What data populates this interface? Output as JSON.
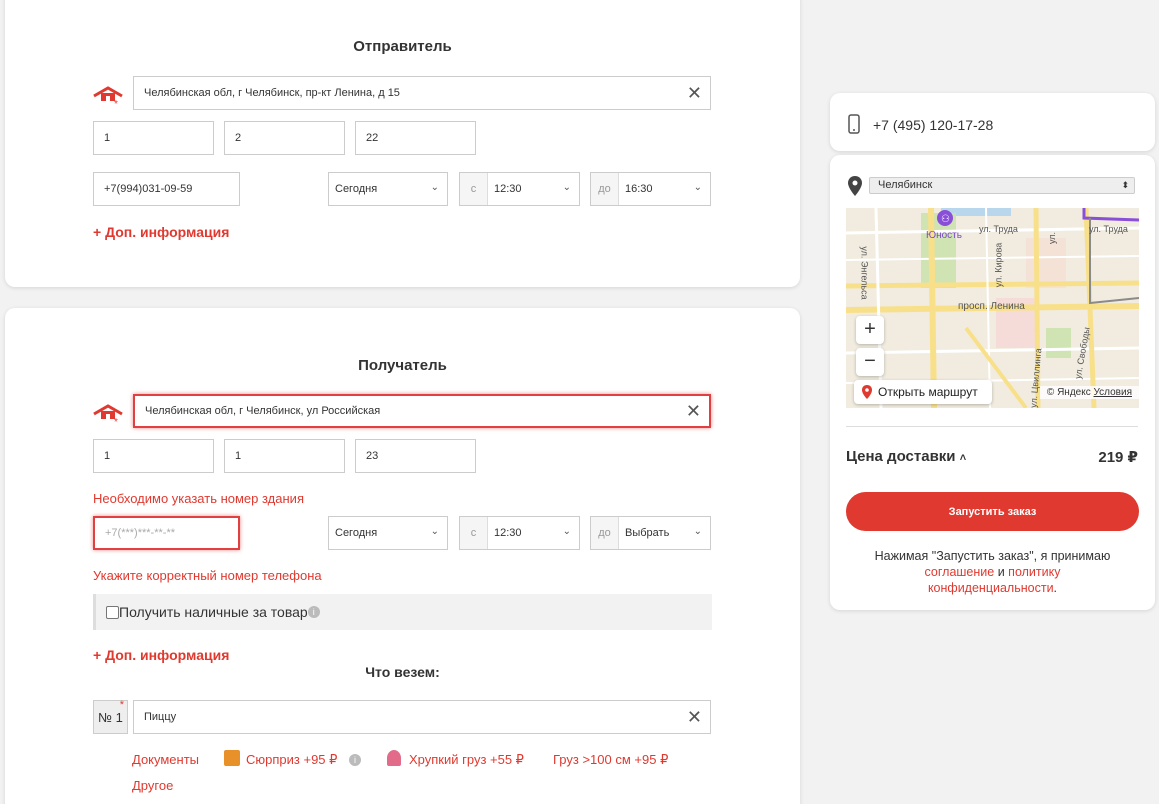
{
  "sender": {
    "title": "Отправитель",
    "address": "Челябинская обл, г Челябинск, пр-кт Ленина, д 15",
    "entrance": "1",
    "floor": "2",
    "apartment": "22",
    "phone": "+7(994)031-09-59",
    "day": "Сегодня",
    "from_prefix": "с",
    "from_time": "12:30",
    "to_prefix": "до",
    "to_time": "16:30",
    "extra_link": "+ Доп. информация"
  },
  "recipient": {
    "title": "Получатель",
    "address": "Челябинская обл, г Челябинск, ул Российская",
    "entrance": "1",
    "floor": "1",
    "apartment": "23",
    "building_error": "Необходимо указать номер здания",
    "phone_placeholder": "+7(***)***-**-**",
    "phone_error": "Укажите корректный номер телефона",
    "day": "Сегодня",
    "from_prefix": "с",
    "from_time": "12:30",
    "to_prefix": "до",
    "to_time": "Выбрать",
    "cash_label": "Получить наличные за товар",
    "extra_link": "+ Доп. информация"
  },
  "cargo": {
    "title": "Что везем:",
    "item_number": "№ 1",
    "item_value": "Пиццу",
    "tags": {
      "documents": "Документы",
      "surprise": "Сюрприз +95 ₽",
      "fragile": "Хрупкий груз +55 ₽",
      "large": "Груз >100 см +95 ₽",
      "other": "Другое"
    }
  },
  "sidebar": {
    "phone": "+7 (495) 120-17-28",
    "city": "Челябинск",
    "map": {
      "open_route": "Открыть маршрут",
      "copyright": "© Яндекс",
      "terms": "Условия",
      "labels": {
        "yunost": "Юность",
        "trud": "ул. Труда",
        "trud2": "ул. Труда",
        "lenina": "просп. Ленина",
        "engelsa": "ул. Энгельса",
        "kirova": "ул. Кирова",
        "svobody": "ул. Свободы",
        "tsvillinga": "ул. Цвиллинга",
        "truda_vert": "ул."
      }
    },
    "price_label": "Цена доставки",
    "price_value": "219 ₽",
    "order_button": "Запустить заказ",
    "agree_prefix": "Нажимая \"Запустить заказ\", я принимаю",
    "agree_link1": "соглашение",
    "agree_and": " и ",
    "agree_link2": "политику",
    "agree_link3": "конфиденциальности",
    "agree_dot": "."
  }
}
